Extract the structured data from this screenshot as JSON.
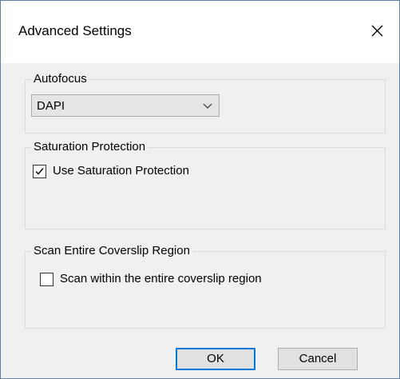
{
  "window": {
    "title": "Advanced Settings",
    "close_icon": "close-icon"
  },
  "autofocus": {
    "group_label": "Autofocus",
    "selected_value": "DAPI",
    "dropdown_icon": "chevron-down-icon"
  },
  "saturation": {
    "group_label": "Saturation Protection",
    "checkbox_label": "Use Saturation Protection",
    "checked": true
  },
  "coverslip": {
    "group_label": "Scan Entire Coverslip Region",
    "checkbox_label": "Scan within the entire coverslip region",
    "checked": false
  },
  "buttons": {
    "ok_label": "OK",
    "cancel_label": "Cancel"
  },
  "colors": {
    "dialog_background": "#f0f0f0",
    "title_background": "#ffffff",
    "default_button_border": "#0078d7"
  }
}
